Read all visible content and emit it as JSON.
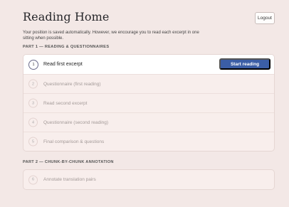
{
  "header": {
    "title": "Reading Home",
    "logout_label": "Logout"
  },
  "intro": "Your position is saved automatically. However, we encourage you to read each excerpt in one sitting when possible.",
  "part1": {
    "label": "PART 1 — READING & QUESTIONNAIRES",
    "steps": [
      {
        "num": "1",
        "label": "Read first excerpt",
        "active": true,
        "action": "Start reading"
      },
      {
        "num": "2",
        "label": "Questionnaire (first reading)"
      },
      {
        "num": "3",
        "label": "Read second excerpt"
      },
      {
        "num": "4",
        "label": "Questionnaire (second reading)"
      },
      {
        "num": "5",
        "label": "Final comparison & questions"
      }
    ]
  },
  "part2": {
    "label": "PART 2 — CHUNK-BY-CHUNK ANNOTATION",
    "steps": [
      {
        "num": "6",
        "label": "Annotate translation pairs"
      }
    ]
  },
  "colors": {
    "background": "#f3e8e6",
    "accent": "#3b5ea6"
  }
}
